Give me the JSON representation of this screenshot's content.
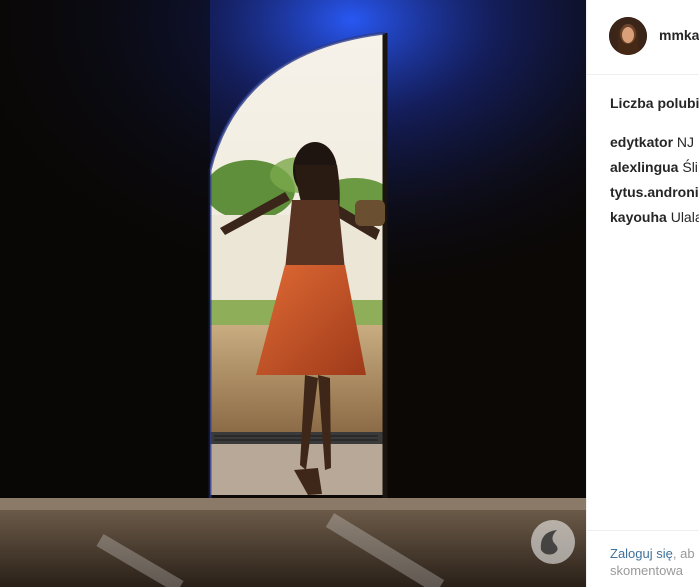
{
  "post": {
    "username": "mmka",
    "likes_label": "Liczba polubie",
    "comments": [
      {
        "author": "edytkator",
        "text": "NJ"
      },
      {
        "author": "alexlingua",
        "text": "Śli"
      },
      {
        "author": "tytus.andronic",
        "text": ""
      },
      {
        "author": "kayouha",
        "text": "Ulala"
      }
    ],
    "footer": {
      "login_link": "Zaloguj się",
      "login_suffix": ", ab",
      "line2": "skomentowa"
    }
  },
  "colors": {
    "sky_blue": "#1a3fd6",
    "dress": "#c8562a",
    "link": "#3f729b"
  },
  "icons": [
    "avatar",
    "watermark-logo-icon"
  ]
}
